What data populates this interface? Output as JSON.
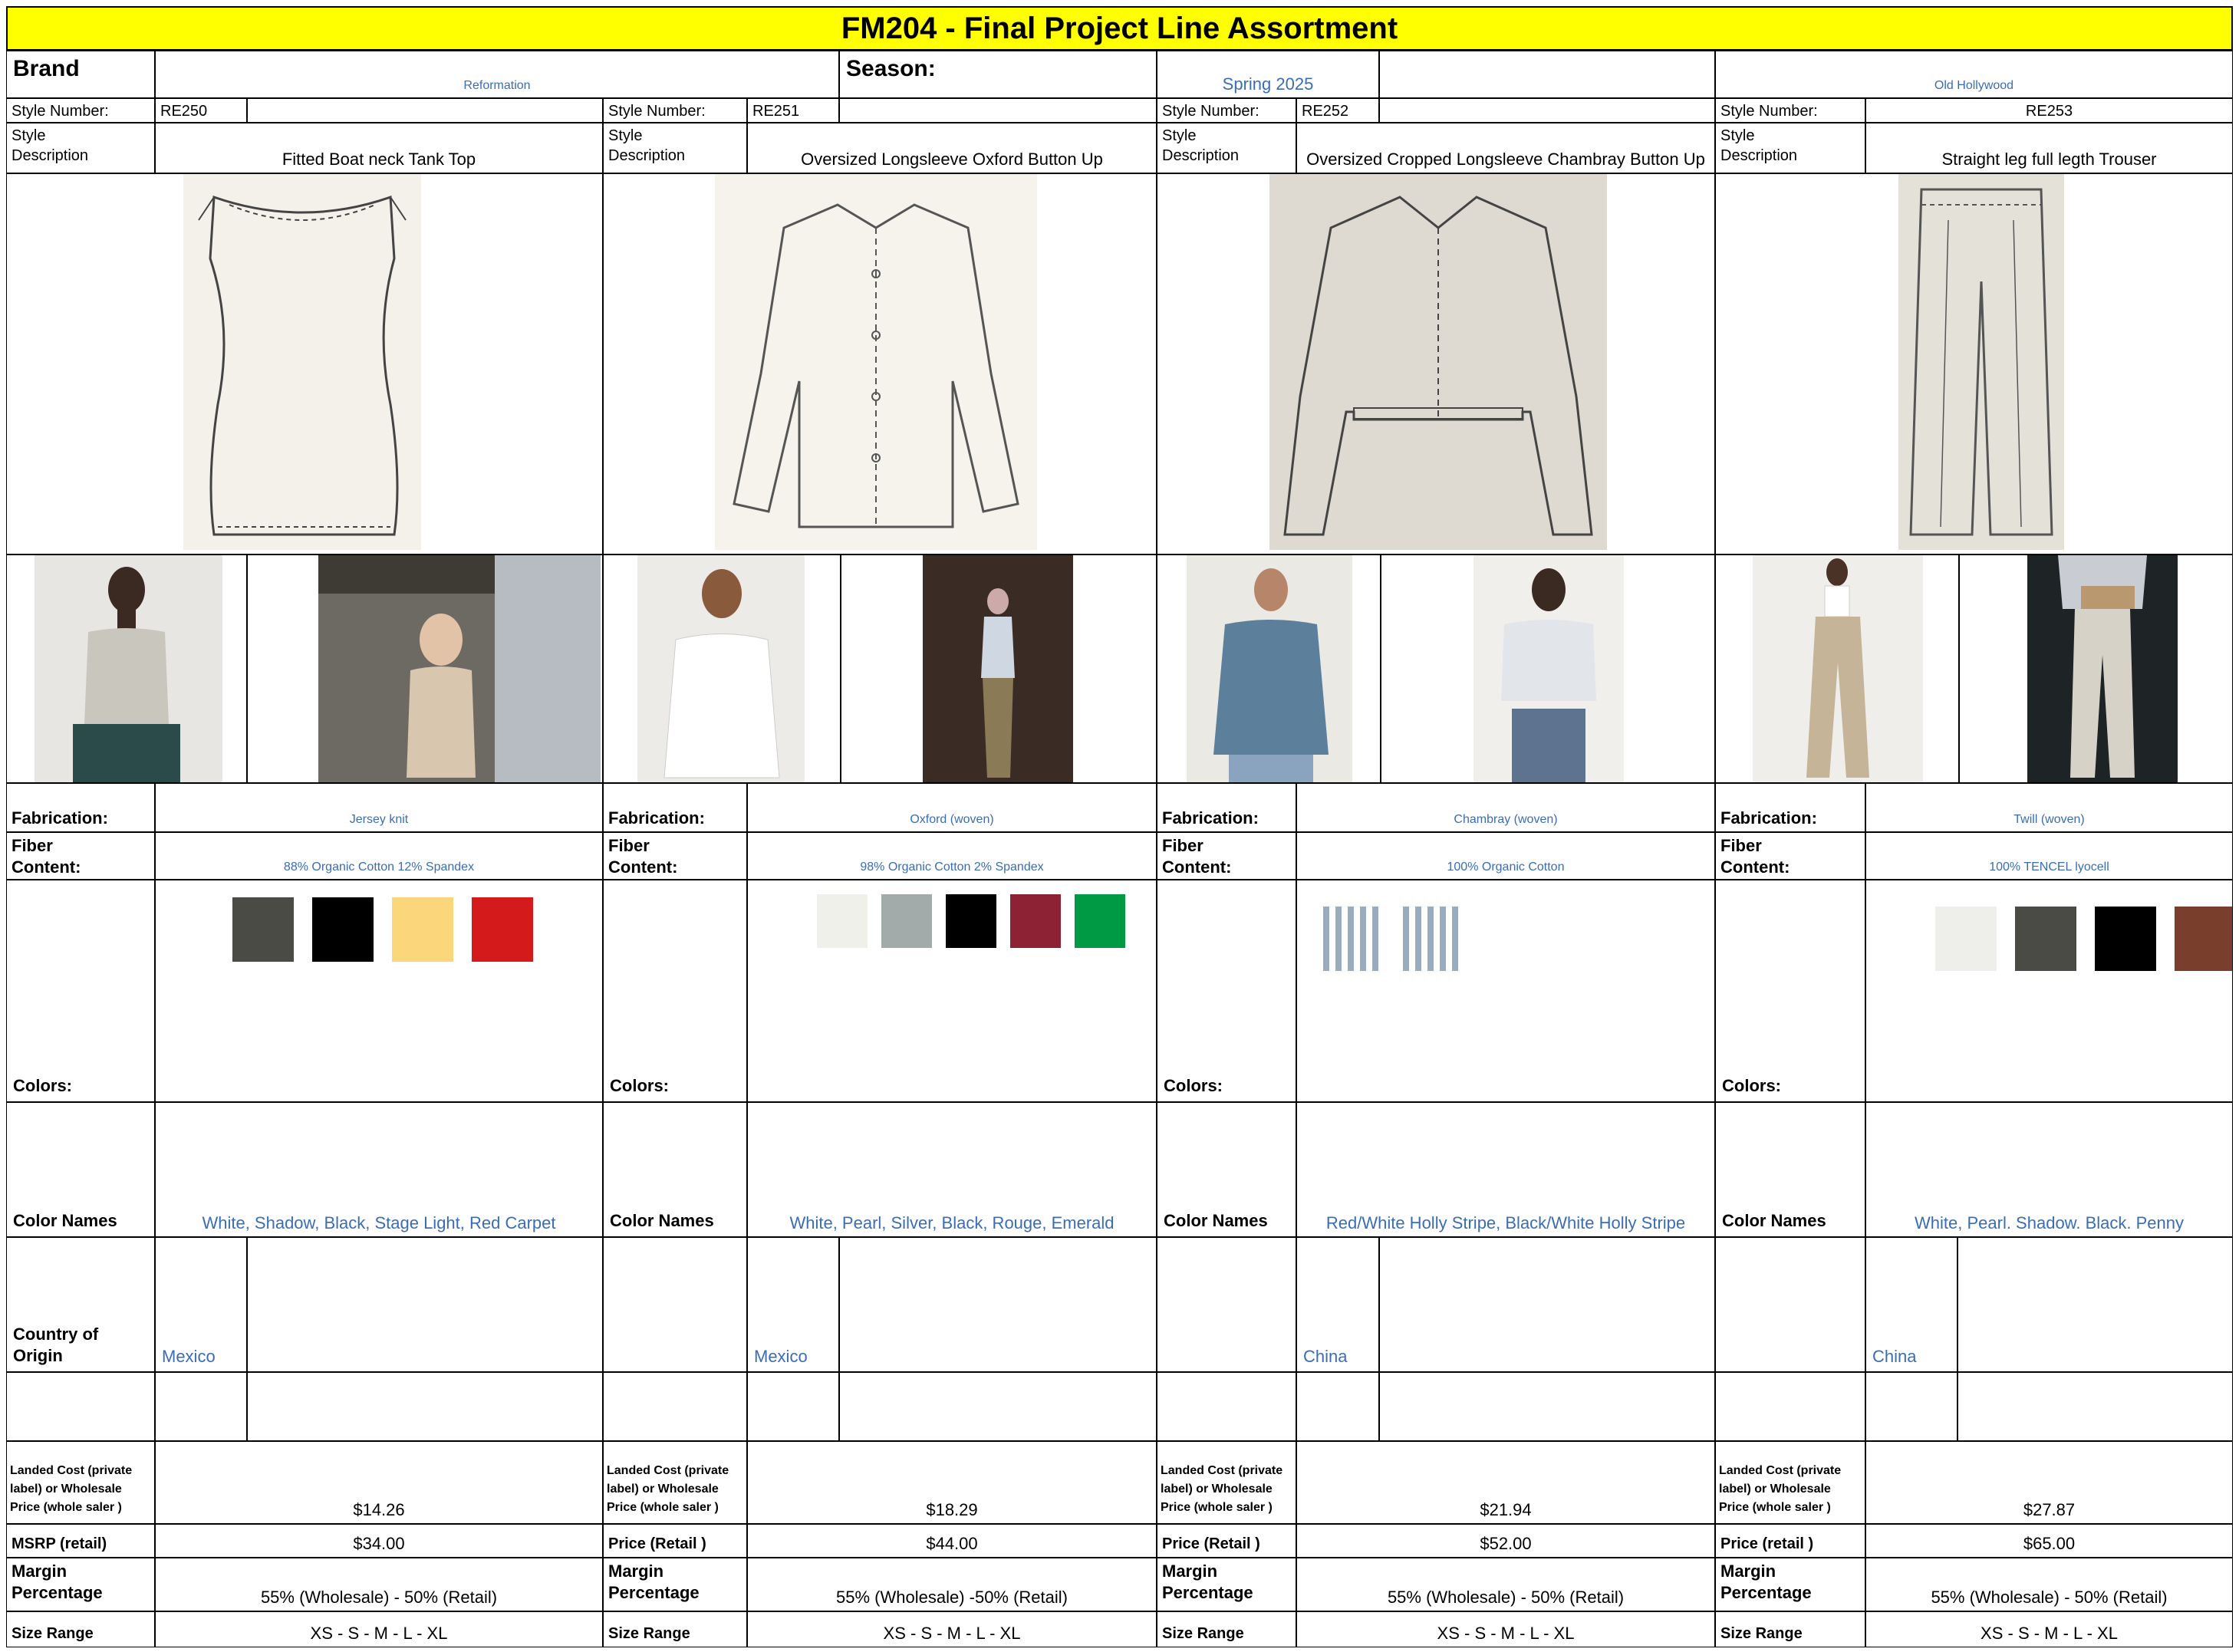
{
  "title": "FM204 - Final Project Line Assortment",
  "brand_label": "Brand",
  "brand_value": "Reformation",
  "season_label": "Season:",
  "season_value": "Spring 2025",
  "theme_value": "Old Hollywood",
  "labels": {
    "style_number": "Style Number:",
    "style_description_1": "Style",
    "style_description_2": "Description",
    "fabrication": "Fabrication:",
    "fiber_1": "Fiber",
    "fiber_2": "Content:",
    "colors": "Colors:",
    "color_names": "Color Names",
    "country": "Country of Origin",
    "landed_cost": "Landed Cost (private label) or Wholesale Price (whole saler )",
    "msrp": "MSRP (retail)",
    "price_retail": "Price (Retail )",
    "price_retail_lower": "Price (retail )",
    "margin_1": "Margin",
    "margin_2": "Percentage",
    "size_range": "Size Range"
  },
  "styles": [
    {
      "style_number": "RE250",
      "description": "Fitted Boat neck Tank Top",
      "fabrication": "Jersey knit",
      "fiber": "88% Organic Cotton 12% Spandex",
      "swatches": [
        "#4b4b45",
        "#000000",
        "#fcd67a",
        "#d41a1a"
      ],
      "color_names": "White, Shadow, Black, Stage Light, Red Carpet",
      "country": "Mexico",
      "cost": "$14.26",
      "retail": "$34.00",
      "margin": "55% (Wholesale) - 50% (Retail)",
      "sizes": "XS - S - M - L - XL"
    },
    {
      "style_number": "RE251",
      "description": "Oversized Longsleeve Oxford Button Up",
      "fabrication": "Oxford (woven)",
      "fiber": "98% Organic Cotton 2% Spandex",
      "swatches": [
        "#f0f0ea",
        "#a3aaaa",
        "#000000",
        "#8c2233",
        "#009a44"
      ],
      "color_names": "White, Pearl, Silver, Black, Rouge, Emerald",
      "country": "Mexico",
      "cost": "$18.29",
      "retail": "$44.00",
      "margin": "55% (Wholesale) -50% (Retail)",
      "sizes": "XS - S - M - L - XL"
    },
    {
      "style_number": "RE252",
      "description": "Oversized Cropped Longsleeve Chambray Button Up",
      "fabrication": "Chambray (woven)",
      "fiber": "100% Organic Cotton",
      "swatches": [],
      "color_names": "Red/White Holly Stripe, Black/White Holly Stripe",
      "country": "China",
      "cost": "$21.94",
      "retail": "$52.00",
      "margin": "55% (Wholesale) - 50% (Retail)",
      "sizes": "XS - S - M - L - XL"
    },
    {
      "style_number": "RE253",
      "description": "Straight leg full legth Trouser",
      "fabrication": "Twill (woven)",
      "fiber": "100% TENCEL lyocell",
      "swatches": [
        "#eeeeea",
        "#4b4b45",
        "#000000",
        "#7a3e2c"
      ],
      "color_names": "White, Pearl. Shadow. Black. Penny",
      "country": "China",
      "cost": "$27.87",
      "retail": "$65.00",
      "margin": "55% (Wholesale) - 50% (Retail)",
      "sizes": "XS - S - M - L - XL"
    }
  ]
}
